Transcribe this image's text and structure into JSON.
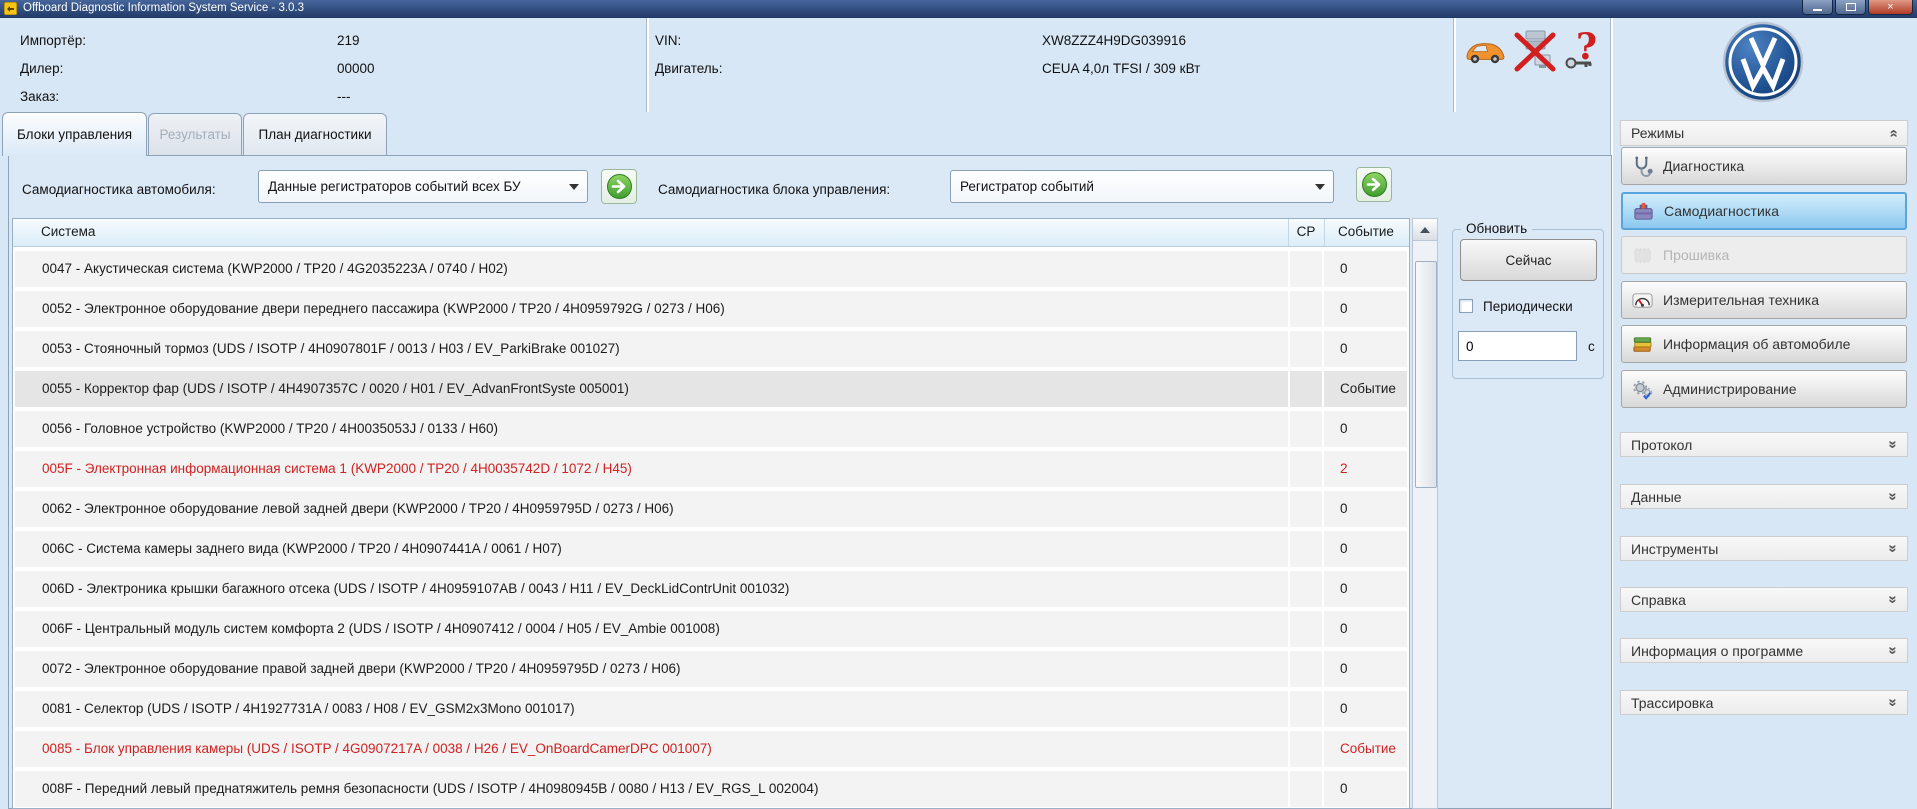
{
  "window": {
    "title": "Offboard Diagnostic Information System Service - 3.0.3"
  },
  "header": {
    "left_fields": [
      {
        "label": "Импортёр:",
        "value": "219"
      },
      {
        "label": "Дилер:",
        "value": "00000"
      },
      {
        "label": "Заказ:",
        "value": "---"
      }
    ],
    "center_fields": [
      {
        "label": "VIN:",
        "value": "XW8ZZZ4H9DG039916"
      },
      {
        "label": "Двигатель:",
        "value": "CEUA 4,0л TFSI / 309 кВт"
      }
    ],
    "status_icons": [
      "vehicle-icon",
      "connection-offline-icon",
      "help-unavailable-icon"
    ],
    "brand": "VW"
  },
  "tabs": [
    {
      "label": "Блоки управления",
      "state": "active"
    },
    {
      "label": "Результаты",
      "state": "disabled"
    },
    {
      "label": "План диагностики",
      "state": "normal"
    }
  ],
  "controls": {
    "vehicle_selfdiag_label": "Самодиагностика автомобиля:",
    "vehicle_selfdiag_value": "Данные регистраторов событий всех БУ",
    "ecu_selfdiag_label": "Самодиагностика блока управления:",
    "ecu_selfdiag_value": "Регистратор событий"
  },
  "table": {
    "columns": [
      "Система",
      "СР",
      "Событие"
    ],
    "rows": [
      {
        "code": "0047",
        "name": "Акустическая система",
        "info": "KWP2000 / TP20 / 4G2035223A / 0740 / H02",
        "cp": "",
        "event": "0",
        "state": "normal"
      },
      {
        "code": "0052",
        "name": "Электронное оборудование двери переднего пассажира",
        "info": "KWP2000 / TP20 / 4H0959792G / 0273 / H06",
        "cp": "",
        "event": "0",
        "state": "normal"
      },
      {
        "code": "0053",
        "name": "Стояночный тормоз",
        "info": "UDS / ISOTP / 4H0907801F / 0013 / H03 / EV_ParkiBrake 001027",
        "cp": "",
        "event": "0",
        "state": "normal"
      },
      {
        "code": "0055",
        "name": "Корректор фар",
        "info": "UDS / ISOTP / 4H4907357C / 0020 / H01 / EV_AdvanFrontSyste 005001",
        "cp": "",
        "event": "Событие",
        "state": "selected"
      },
      {
        "code": "0056",
        "name": "Головное устройство",
        "info": "KWP2000 / TP20 / 4H0035053J / 0133 / H60",
        "cp": "",
        "event": "0",
        "state": "normal"
      },
      {
        "code": "005F",
        "name": "Электронная информационная система 1",
        "info": "KWP2000 / TP20 / 4H0035742D / 1072 / H45",
        "cp": "",
        "event": "2",
        "state": "error"
      },
      {
        "code": "0062",
        "name": "Электронное оборудование левой задней двери",
        "info": "KWP2000 / TP20 / 4H0959795D / 0273 / H06",
        "cp": "",
        "event": "0",
        "state": "normal"
      },
      {
        "code": "006C",
        "name": "Система камеры заднего вида",
        "info": "KWP2000 / TP20 / 4H0907441A / 0061 / H07",
        "cp": "",
        "event": "0",
        "state": "normal"
      },
      {
        "code": "006D",
        "name": "Электроника крышки багажного отсека",
        "info": "UDS / ISOTP / 4H0959107AB / 0043 / H11 / EV_DeckLidContrUnit 001032",
        "cp": "",
        "event": "0",
        "state": "normal"
      },
      {
        "code": "006F",
        "name": "Центральный модуль систем комфорта 2",
        "info": "UDS / ISOTP / 4H0907412 / 0004 / H05 / EV_Ambie 001008",
        "cp": "",
        "event": "0",
        "state": "normal"
      },
      {
        "code": "0072",
        "name": "Электронное оборудование правой задней двери",
        "info": "KWP2000 / TP20 / 4H0959795D / 0273 / H06",
        "cp": "",
        "event": "0",
        "state": "normal"
      },
      {
        "code": "0081",
        "name": "Селектор",
        "info": "UDS / ISOTP / 4H1927731A / 0083 / H08 / EV_GSM2x3Mono 001017",
        "cp": "",
        "event": "0",
        "state": "normal"
      },
      {
        "code": "0085",
        "name": "Блок управления камеры",
        "info": "UDS / ISOTP / 4G0907217A / 0038 / H26 / EV_OnBoardCamerDPC 001007",
        "cp": "",
        "event": "Событие",
        "state": "error"
      },
      {
        "code": "008F",
        "name": "Передний левый преднатяжитель ремня безопасности",
        "info": "UDS / ISOTP / 4H0980945B / 0080 / H13 / EV_RGS_L 002004",
        "cp": "",
        "event": "0",
        "state": "normal"
      }
    ]
  },
  "refresh": {
    "group_title": "Обновить",
    "now_button": "Сейчас",
    "periodic_label": "Периодически",
    "interval_value": "0",
    "interval_unit": "с"
  },
  "sidebar": {
    "modes_title": "Режимы",
    "modes": [
      {
        "label": "Диагностика",
        "icon": "stethoscope-icon",
        "state": "normal"
      },
      {
        "label": "Самодиагностика",
        "icon": "toolbox-icon",
        "state": "active"
      },
      {
        "label": "Прошивка",
        "icon": "ecu-flash-icon",
        "state": "disabled"
      },
      {
        "label": "Измерительная техника",
        "icon": "gauge-icon",
        "state": "normal"
      },
      {
        "label": "Информация об автомобиле",
        "icon": "books-icon",
        "state": "normal"
      },
      {
        "label": "Администрирование",
        "icon": "gears-icon",
        "state": "normal"
      }
    ],
    "sections": [
      "Протокол",
      "Данные",
      "Инструменты",
      "Справка",
      "Информация о программе",
      "Трассировка"
    ]
  },
  "colors": {
    "error_text": "#cf2222",
    "active_mode_border": "#58a5dc",
    "brand_blue": "#1c4e8e"
  }
}
